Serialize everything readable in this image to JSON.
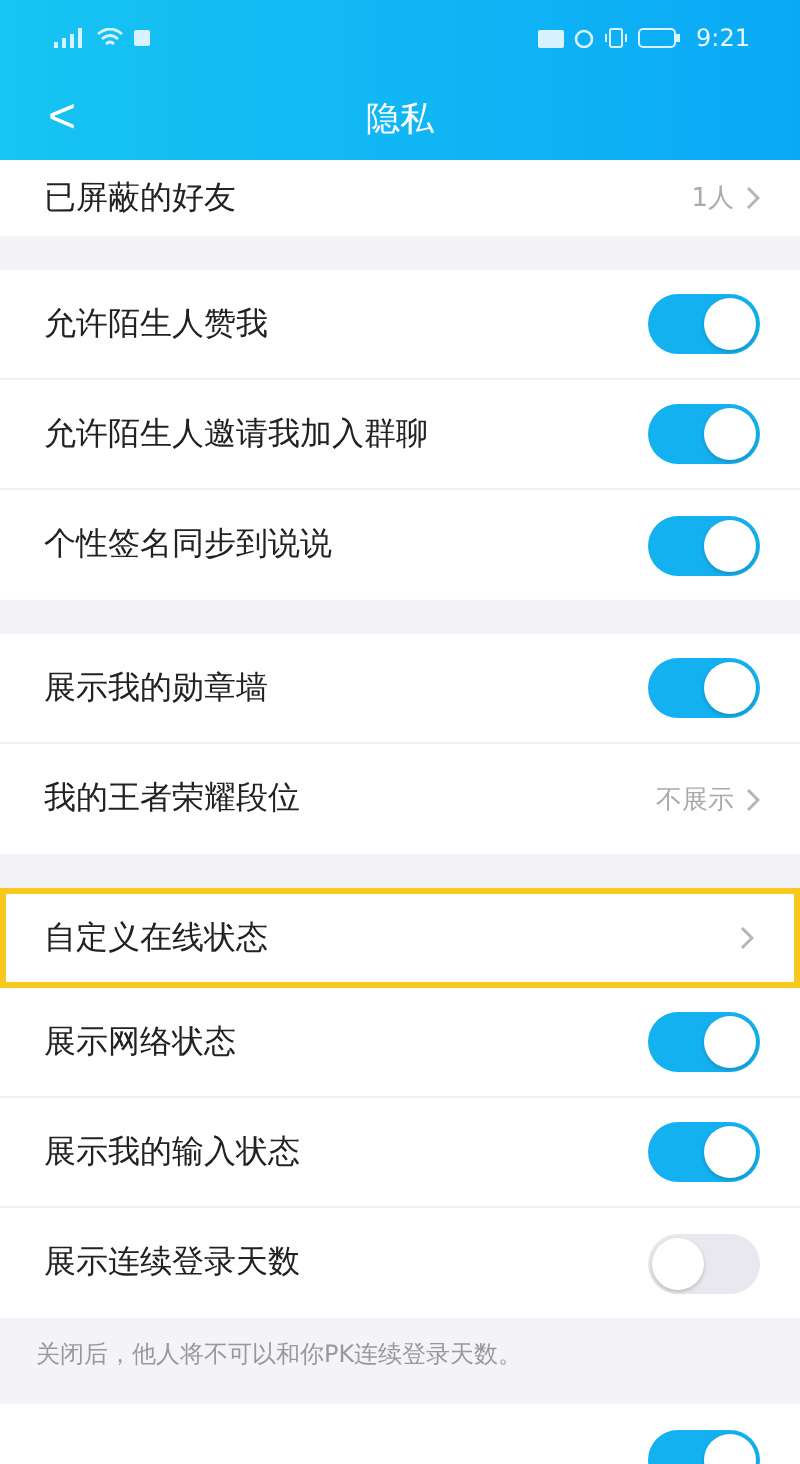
{
  "status_bar": {
    "time": "9:21"
  },
  "header": {
    "back": "<",
    "title": "隐私"
  },
  "groups": [
    {
      "rows": [
        {
          "kind": "link",
          "label": "已屏蔽的好友",
          "value": "1人",
          "highlighted": false
        }
      ]
    },
    {
      "rows": [
        {
          "kind": "toggle",
          "label": "允许陌生人赞我",
          "on": true
        },
        {
          "kind": "toggle",
          "label": "允许陌生人邀请我加入群聊",
          "on": true
        },
        {
          "kind": "toggle",
          "label": "个性签名同步到说说",
          "on": true
        }
      ]
    },
    {
      "rows": [
        {
          "kind": "toggle",
          "label": "展示我的勋章墙",
          "on": true
        },
        {
          "kind": "link",
          "label": "我的王者荣耀段位",
          "value": "不展示",
          "highlighted": false
        }
      ]
    },
    {
      "rows": [
        {
          "kind": "link",
          "label": "自定义在线状态",
          "highlighted": true
        },
        {
          "kind": "toggle",
          "label": "展示网络状态",
          "on": true
        },
        {
          "kind": "toggle",
          "label": "展示我的输入状态",
          "on": true
        },
        {
          "kind": "toggle",
          "label": "展示连续登录天数",
          "on": false
        }
      ],
      "note": "关闭后，他人将不可以和你PK连续登录天数。"
    },
    {
      "rows": [
        {
          "kind": "toggle",
          "on": true
        }
      ]
    }
  ]
}
